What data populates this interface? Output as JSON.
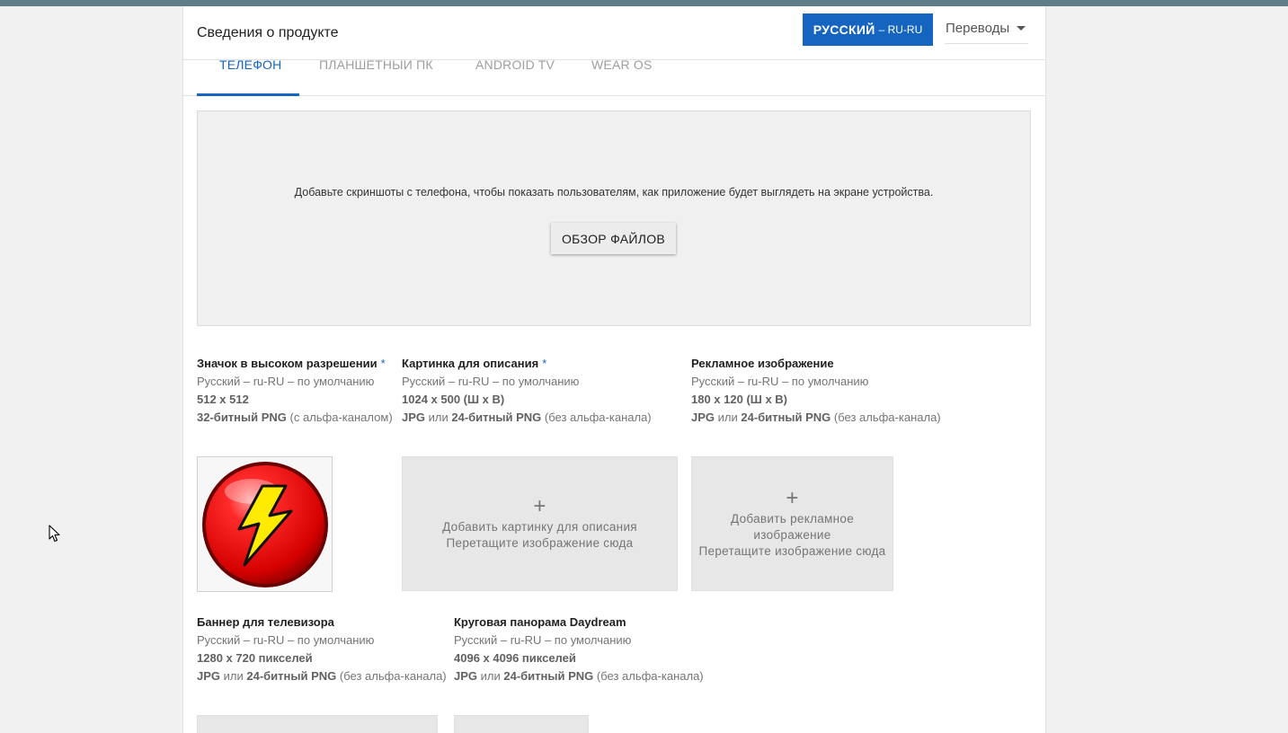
{
  "header": {
    "title": "Сведения о продукте",
    "language_button": {
      "name": "РУССКИЙ",
      "code": "– RU-RU"
    },
    "translations_label": "Переводы"
  },
  "tabs": [
    {
      "label": "ТЕЛЕФОН",
      "active": true
    },
    {
      "label": "ПЛАНШЕТНЫЙ ПК",
      "active": false
    },
    {
      "label": "ANDROID TV",
      "active": false
    },
    {
      "label": "WEAR OS",
      "active": false
    }
  ],
  "dropzone": {
    "text": "Добавьте скриншоты с телефона, чтобы показать пользователям, как приложение будет выглядеть на экране устройства.",
    "button": "ОБЗОР ФАЙЛОВ"
  },
  "assets": {
    "icon": {
      "title": "Значок в высоком разрешении",
      "required": "*",
      "lang": "Русский – ru-RU – по умолчанию",
      "size": "512 x 512",
      "format_bold": "32-битный PNG",
      "format_rest": " (с альфа-каналом)"
    },
    "feature": {
      "title": "Картинка для описания",
      "required": "*",
      "lang": "Русский – ru-RU – по умолчанию",
      "size": "1024 x 500 (Ш x В)",
      "fmt1": "JPG",
      "or": " или ",
      "fmt2": "24-битный PNG",
      "rest": " (без альфа-канала)",
      "add_line1": "Добавить картинку для описания",
      "add_line2": "Перетащите изображение сюда"
    },
    "promo": {
      "title": "Рекламное изображение",
      "lang": "Русский – ru-RU – по умолчанию",
      "size": "180 x 120 (Ш x В)",
      "fmt1": "JPG",
      "or": " или ",
      "fmt2": "24-битный PNG",
      "rest": " (без альфа-канала)",
      "add_line1": "Добавить рекламное",
      "add_line2": "изображение",
      "add_line3": "Перетащите изображение сюда"
    },
    "tv_banner": {
      "title": "Баннер для телевизора",
      "lang": "Русский – ru-RU – по умолчанию",
      "size": "1280 x 720 пикселей",
      "fmt1": "JPG",
      "or": " или ",
      "fmt2": "24-битный PNG",
      "rest": " (без альфа-канала)"
    },
    "daydream": {
      "title": "Круговая панорама Daydream",
      "lang": "Русский – ru-RU – по умолчанию",
      "size": "4096 x 4096 пикселей",
      "fmt1": "JPG",
      "or": " или ",
      "fmt2": "24-битный PNG",
      "rest": " (без альфа-канала)"
    }
  },
  "plus_glyph": "+",
  "colors": {
    "accent": "#1565c0",
    "topbar": "#607d8b",
    "icon_red": "#e51c23",
    "icon_bolt": "#ffeb00"
  }
}
